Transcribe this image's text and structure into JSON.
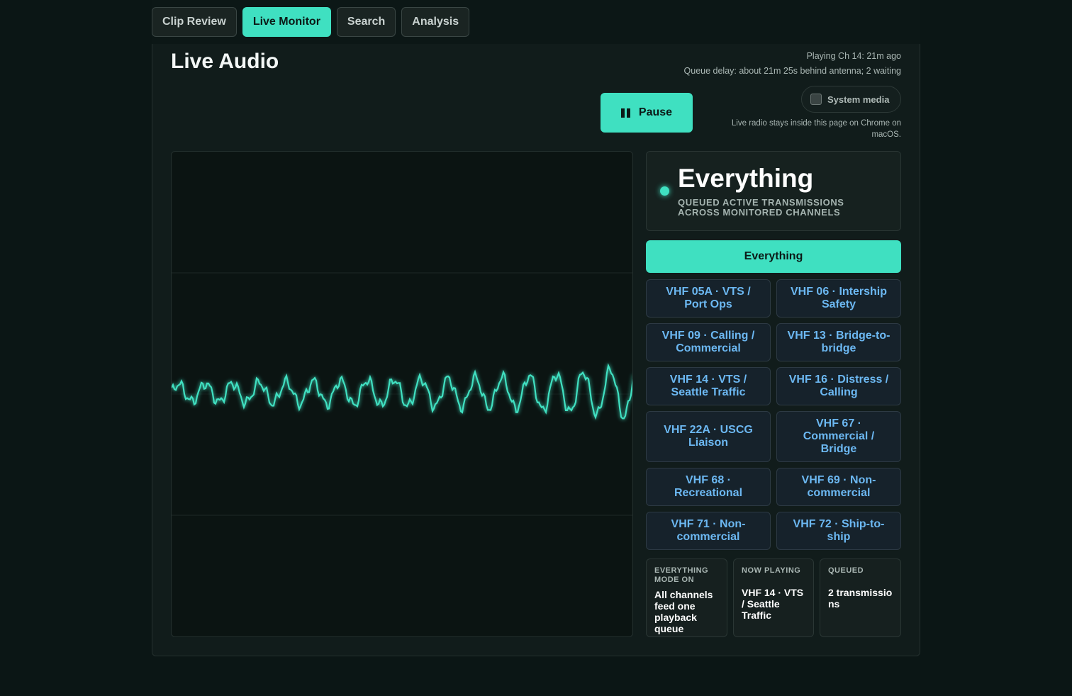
{
  "nav": {
    "tabs": [
      {
        "label": "Clip Review",
        "active": false
      },
      {
        "label": "Live Monitor",
        "active": true
      },
      {
        "label": "Search",
        "active": false
      },
      {
        "label": "Analysis",
        "active": false
      }
    ]
  },
  "header": {
    "title": "Live Audio",
    "playing_status": "Playing Ch 14: 21m ago",
    "queue_delay": "Queue delay: about 21m 25s behind antenna; 2 waiting"
  },
  "controls": {
    "pause_label": "Pause",
    "system_media_label": "System media",
    "system_media_checked": false,
    "system_media_note": "Live radio stays inside this page on Chrome on macOS."
  },
  "mode": {
    "name": "Everything",
    "description": "QUEUED ACTIVE TRANSMISSIONS ACROSS MONITORED CHANNELS",
    "button_label": "Everything"
  },
  "channels": [
    "VHF 05A · VTS / Port Ops",
    "VHF 06 · Intership Safety",
    "VHF 09 · Calling / Commercial",
    "VHF 13 · Bridge-to-bridge",
    "VHF 14 · VTS / Seattle Traffic",
    "VHF 16 · Distress / Calling",
    "VHF 22A · USCG Liaison",
    "VHF 67 · Commercial / Bridge",
    "VHF 68 · Recreational",
    "VHF 69 · Non-commercial",
    "VHF 71 · Non-commercial",
    "VHF 72 · Ship-to-ship"
  ],
  "stats": {
    "mode_label": "EVERYTHING MODE ON",
    "mode_value": "All channels feed one playback queue",
    "now_playing_label": "NOW PLAYING",
    "now_playing_value": "VHF 14 · VTS / Seattle Traffic",
    "queued_label": "QUEUED",
    "queued_value": "2 transmissions"
  },
  "colors": {
    "accent": "#3fe0c1",
    "channel_text": "#6cb8f2",
    "background": "#0b1615"
  }
}
